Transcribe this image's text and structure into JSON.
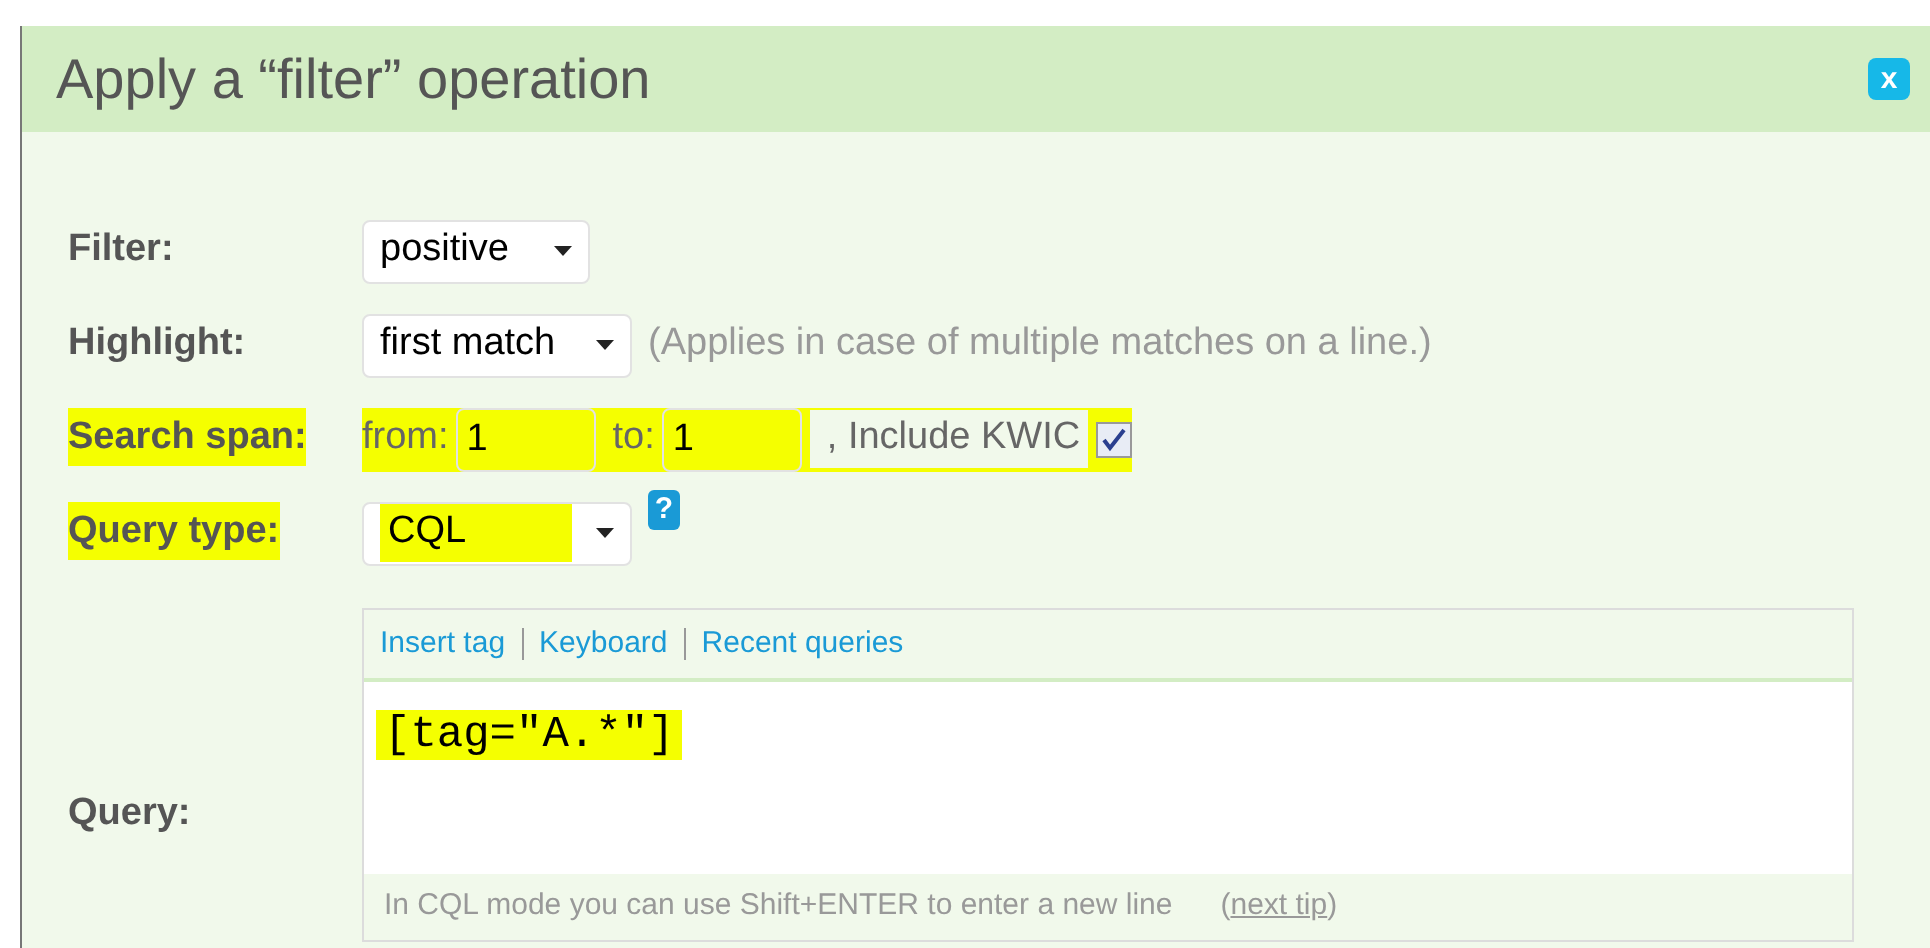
{
  "dialog": {
    "title": "Apply a “filter” operation",
    "close": "x"
  },
  "rows": [
    {
      "kind": "select",
      "label": "Filter:",
      "highlighted": false,
      "value": "positive"
    },
    {
      "kind": "select",
      "label": "Highlight:",
      "highlighted": false,
      "value": "first match",
      "note": "(Applies in case of multiple matches on a line.)"
    },
    {
      "kind": "span",
      "label": "Search span:",
      "highlighted": true,
      "from_label": "from:",
      "from": "1",
      "to_label": "to:",
      "to": "1",
      "kwic_label": ", Include KWIC",
      "kwic_checked": true
    },
    {
      "kind": "select",
      "label": "Query type:",
      "highlighted": true,
      "value": "CQL",
      "help": "?"
    }
  ],
  "query": {
    "label": "Query:",
    "tools": [
      "Insert tag",
      "Keyboard",
      "Recent queries"
    ],
    "value": "[tag=\"A.*\"]",
    "highlighted": true,
    "hint": "In CQL mode you can use Shift+ENTER to enter a new line",
    "tip_open": "(",
    "tip_link": "next tip",
    "tip_close": ")"
  }
}
